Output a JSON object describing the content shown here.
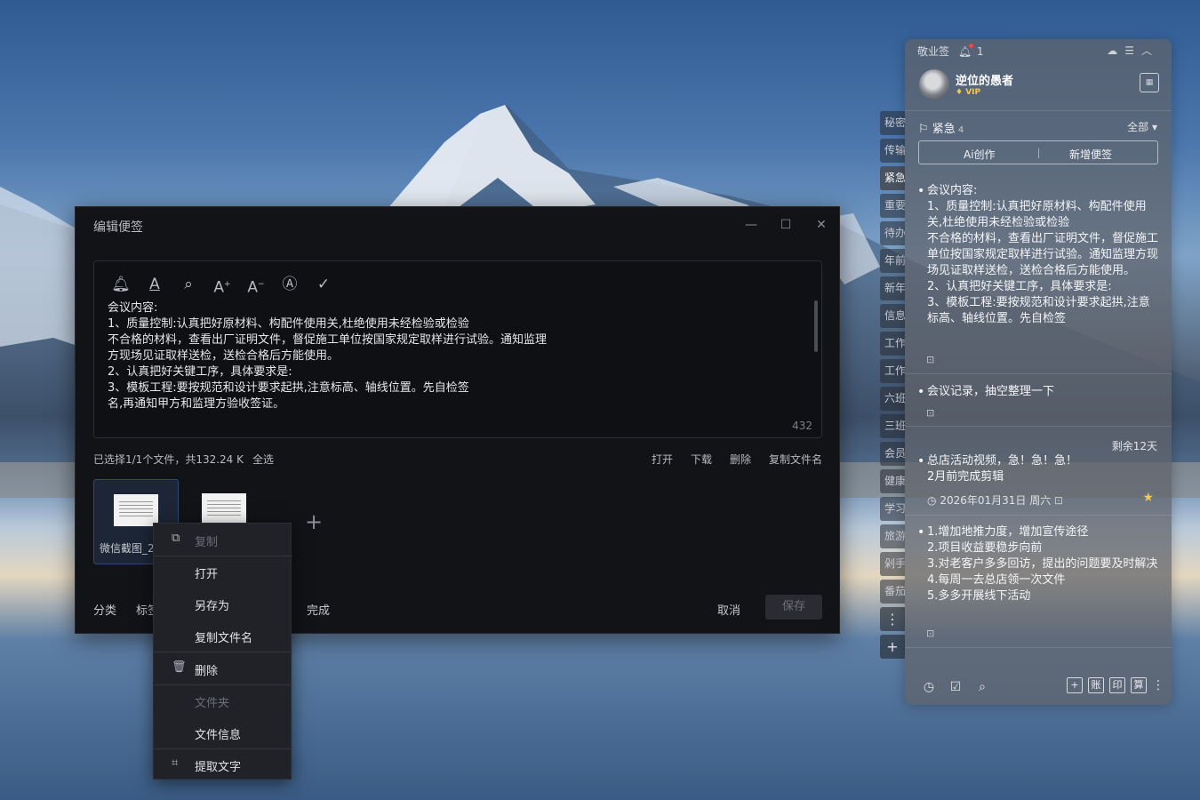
{
  "editor": {
    "title": "编辑便签",
    "window_controls": [
      "—",
      "☐",
      "✕"
    ],
    "toolbar_icons": [
      "bell-icon",
      "text-color-icon",
      "search-icon",
      "font-increase-icon",
      "font-decrease-icon",
      "text-style-icon",
      "check-icon"
    ],
    "note_text": "会议内容:\n1、质量控制:认真把好原材料、构配件使用关,杜绝使用未经检验或检验\n不合格的材料，查看出厂证明文件，督促施工单位按国家规定取样进行试验。通知监理\n方现场见证取样送检，送检合格后方能使用。\n2、认真把好关键工序，具体要求是:\n3、模板工程:要按规范和设计要求起拱,注意标高、轴线位置。先自检签\n名,再通知甲方和监理方验收签证。",
    "char_count": "432",
    "file_info": "已选择1/1个文件，共132.24 K",
    "select_all": "全选",
    "file_actions": [
      "打开",
      "下载",
      "删除",
      "复制文件名"
    ],
    "file_name": "微信截图_20",
    "add_symbol": "+",
    "footer": {
      "category": "分类",
      "tag": "标签",
      "done": "完成",
      "cancel": "取消",
      "save": "保存"
    }
  },
  "context_menu": {
    "items": [
      {
        "label": "复制",
        "icon": "copy-icon",
        "disabled": true
      },
      {
        "label": "打开",
        "icon": "",
        "disabled": false
      },
      {
        "label": "另存为",
        "icon": "",
        "disabled": false
      },
      {
        "label": "复制文件名",
        "icon": "",
        "disabled": false
      },
      {
        "label": "删除",
        "icon": "trash-icon",
        "disabled": false
      },
      {
        "label": "文件夹",
        "icon": "",
        "disabled": true
      },
      {
        "label": "文件信息",
        "icon": "",
        "disabled": false
      },
      {
        "label": "提取文字",
        "icon": "ocr-icon",
        "disabled": false
      }
    ]
  },
  "side_tabs": [
    "秘密",
    "传输",
    "紧急",
    "重要",
    "待办",
    "年前",
    "新年",
    "信息",
    "工作",
    "工作",
    "六班",
    "三班",
    "会员",
    "健康",
    "学习",
    "旅游",
    "剁手",
    "番茄"
  ],
  "side_more": "⋮",
  "side_add": "+",
  "panel": {
    "app_name": "敬业签",
    "notification_count": "1",
    "username": "逆位的愚者",
    "vip_label": "VIP",
    "category": "紧急",
    "category_count": "4",
    "filter_all": "全部 ▾",
    "ai_button": "Ai创作",
    "new_button": "新增便签",
    "notes": [
      {
        "text": "会议内容:\n1、质量控制:认真把好原材料、构配件使用关,杜绝使用未经检验或检验\n不合格的材料，查看出厂证明文件，督促施工单位按国家规定取样进行试验。通知监理方现场见证取样送检，送检合格后方能使用。\n2、认真把好关键工序，具体要求是:\n3、模板工程:要按规范和设计要求起拱,注意标高、轴线位置。先自检签"
      },
      {
        "text": "会议记录，抽空整理一下"
      },
      {
        "text": "总店活动视频，急！急！急！\n2月前完成剪辑"
      },
      {
        "text": "1.增加地推力度，增加宣传途径\n2.项目收益要稳步向前\n3.对老客户多多回访，提出的问题要及时解决\n4.每周一去总店领一次文件\n5.多多开展线下活动"
      }
    ],
    "remaining": "剩余12天",
    "date": "2026年01月31日 周六",
    "bottom_boxes": [
      "+",
      "账",
      "印",
      "算"
    ],
    "accent_star": "#f2c94c"
  }
}
